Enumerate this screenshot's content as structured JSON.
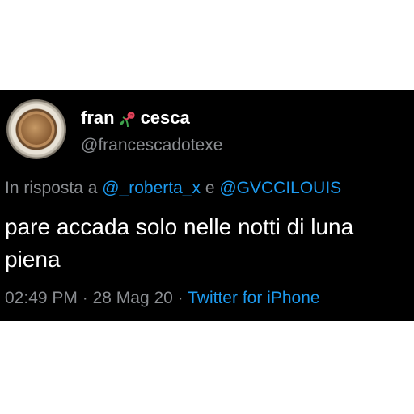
{
  "tweet": {
    "display_name_part1": "fran",
    "display_name_emoji": "wilted-flower-icon",
    "display_name_part2": "cesca",
    "handle": "@francescadotexe",
    "reply_prefix": "In risposta a",
    "reply_mention_1": "@_roberta_x",
    "reply_conjunction": "e",
    "reply_mention_2": "@GVCCILOUIS",
    "text": "pare accada solo nelle notti di luna piena",
    "time": "02:49 PM",
    "separator_1": "·",
    "date": "28 Mag 20",
    "separator_2": "·",
    "source": "Twitter for iPhone"
  },
  "colors": {
    "background": "#000000",
    "text": "#ffffff",
    "secondary_text": "#8a8d91",
    "accent": "#1d9bf0"
  }
}
